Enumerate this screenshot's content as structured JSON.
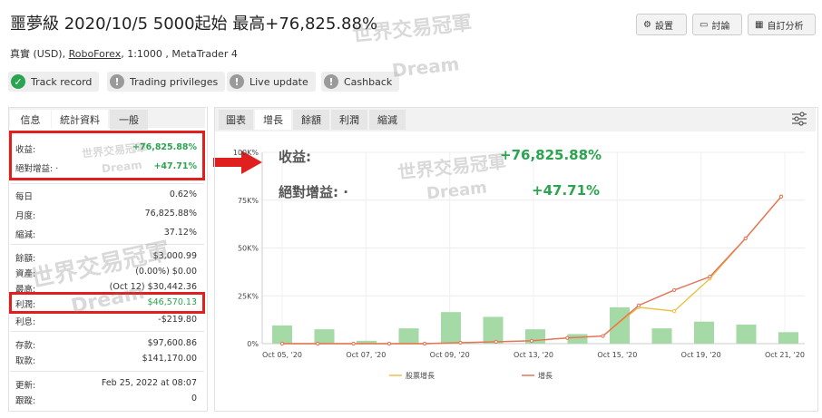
{
  "header": {
    "title": "噩夢級 2020/10/5 5000起始 最高+76,825.88%",
    "account_type": "真實 (USD),",
    "broker": "RoboForex",
    "account_details": ", 1:1000 , MetaTrader 4",
    "buttons": {
      "settings": "設置",
      "discuss": "討論",
      "subscribe": "自訂分析"
    }
  },
  "badges": [
    {
      "label": "Track record",
      "status": "ok",
      "color": "#2aa44f"
    },
    {
      "label": "Trading privileges",
      "status": "warn",
      "color": "#9a9a9a"
    },
    {
      "label": "Live update",
      "status": "warn",
      "color": "#9a9a9a"
    },
    {
      "label": "Cashback",
      "status": "warn",
      "color": "#9a9a9a"
    }
  ],
  "left_panel": {
    "tabs": [
      "信息",
      "統計資料",
      "一般"
    ],
    "gain_label": "收益:",
    "gain_value": "+76,825.88%",
    "abs_gain_label": "絕對增益: ·",
    "abs_gain_value": "+47.71%",
    "daily_label": "每日",
    "daily_value": "0.62%",
    "monthly_label": "月度:",
    "monthly_value": "76,825.88%",
    "drawdown_label": "縮減:",
    "drawdown_value": "37.12%",
    "balance_label": "餘額:",
    "balance_value": "$3,000.99",
    "equity_label": "資產:",
    "equity_value": "(0.00%) $0.00",
    "highest_label": "最高:",
    "highest_value": "(Oct 12) $30,442.36",
    "profit_label": "利潤:",
    "profit_value": "$46,570.13",
    "interest_label": "利息:",
    "interest_value": "-$219.80",
    "deposits_label": "存款:",
    "deposits_value": "$97,600.86",
    "withdrawals_label": "取款:",
    "withdrawals_value": "$141,170.00",
    "updated_label": "更新:",
    "updated_value": "Feb 25, 2022 at 08:07",
    "tracking_label": "跟蹤:",
    "tracking_value": "0"
  },
  "chart_panel": {
    "tabs": [
      "圖表",
      "增長",
      "餘額",
      "利潤",
      "縮減"
    ],
    "overlay_gain_label": "收益:",
    "overlay_gain_value": "+76,825.88%",
    "overlay_abs_label": "絕對增益: ·",
    "overlay_abs_value": "+47.71%"
  },
  "watermark": {
    "line1": "世界交易冠軍",
    "line2": "Dream"
  },
  "colors": {
    "green": "#2aa44f",
    "red": "#e0201f",
    "equity_line": "#e8c24a",
    "growth_line": "#e3735a",
    "bars": "#a5d9a6"
  },
  "chart_data": {
    "type": "line",
    "ylim": [
      0,
      100000
    ],
    "yticks": [
      0,
      25000,
      50000,
      75000,
      100000
    ],
    "ytick_labels": [
      "0%",
      "25K%",
      "50K%",
      "75K%",
      "100K%"
    ],
    "xtick_labels": [
      "Oct 05, '20",
      "Oct 07, '20",
      "Oct 09, '20",
      "Oct 13, '20",
      "Oct 15, '20",
      "Oct 19, '20",
      "Oct 21, '20"
    ],
    "series": [
      {
        "name": "股票增長",
        "color": "#e8c24a",
        "values": [
          0,
          0,
          0,
          0,
          0,
          500,
          1000,
          1500,
          3000,
          4000,
          19000,
          17000,
          34000,
          55000,
          77000
        ]
      },
      {
        "name": "增長",
        "color": "#e3735a",
        "values": [
          0,
          0,
          0,
          0,
          0,
          500,
          1000,
          1500,
          3000,
          4000,
          20000,
          28000,
          35000,
          55000,
          76826
        ]
      }
    ],
    "bars": [
      9500,
      7500,
      1500,
      8000,
      16500,
      14000,
      7500,
      5000,
      19000,
      8000,
      11500,
      10000,
      6000
    ],
    "legend": [
      "股票增長",
      "增長"
    ],
    "legend_position": "bottom"
  }
}
